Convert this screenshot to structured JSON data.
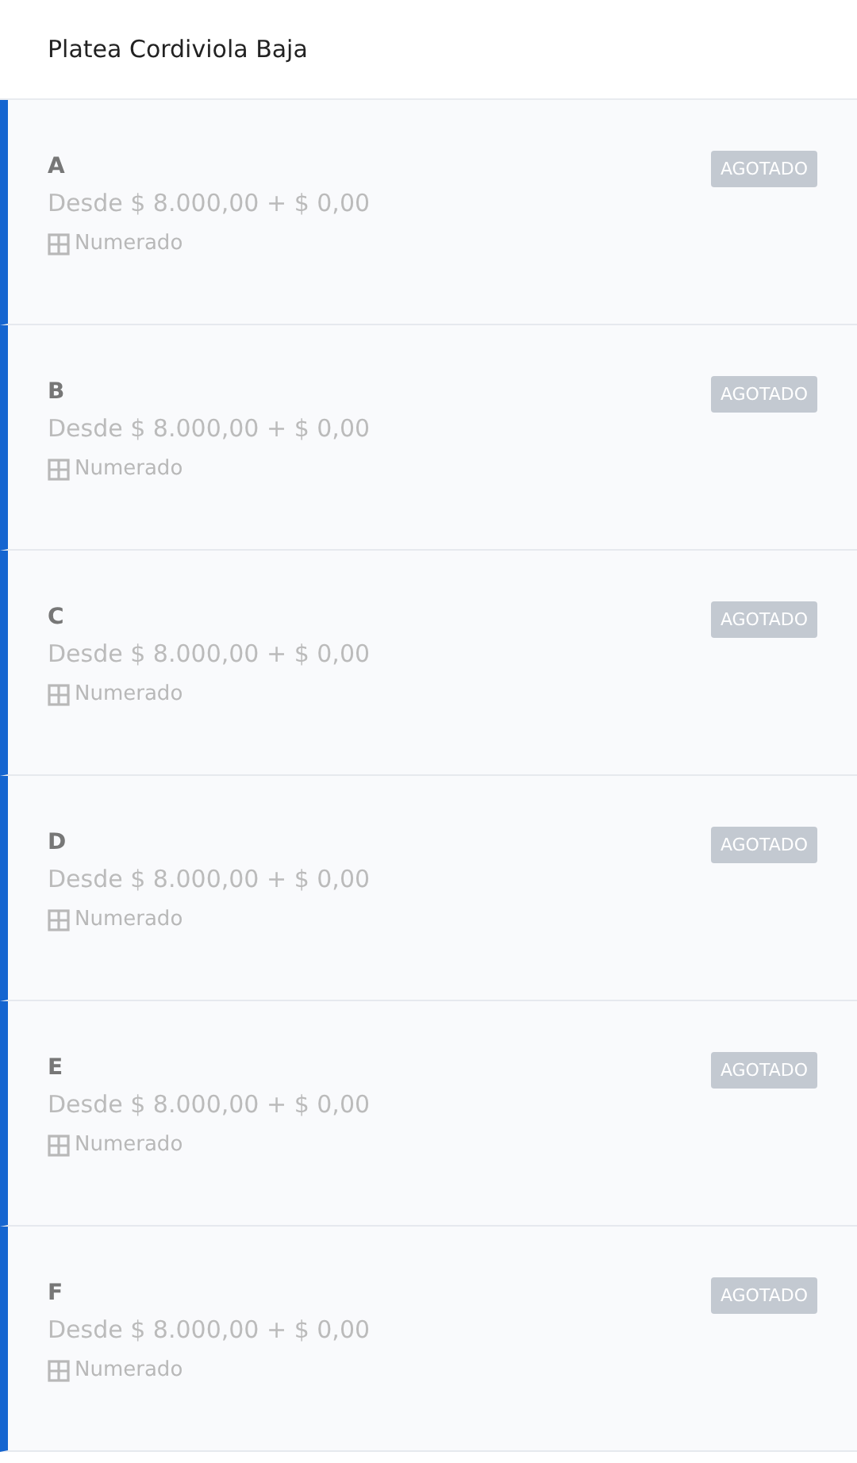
{
  "header": {
    "title": "Platea Cordiviola Baja"
  },
  "sections": [
    {
      "name": "A",
      "price": "Desde $ 8.000,00 + $ 0,00",
      "seating": "Numerado",
      "badge": "AGOTADO"
    },
    {
      "name": "B",
      "price": "Desde $ 8.000,00 + $ 0,00",
      "seating": "Numerado",
      "badge": "AGOTADO"
    },
    {
      "name": "C",
      "price": "Desde $ 8.000,00 + $ 0,00",
      "seating": "Numerado",
      "badge": "AGOTADO"
    },
    {
      "name": "D",
      "price": "Desde $ 8.000,00 + $ 0,00",
      "seating": "Numerado",
      "badge": "AGOTADO"
    },
    {
      "name": "E",
      "price": "Desde $ 8.000,00 + $ 0,00",
      "seating": "Numerado",
      "badge": "AGOTADO"
    },
    {
      "name": "F",
      "price": "Desde $ 8.000,00 + $ 0,00",
      "seating": "Numerado",
      "badge": "AGOTADO"
    }
  ]
}
